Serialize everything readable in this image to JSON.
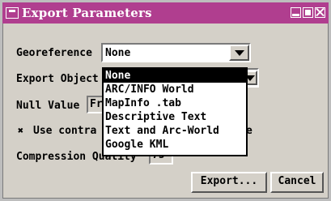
{
  "window": {
    "title": "Export Parameters"
  },
  "fields": {
    "georeference": {
      "label": "Georeference",
      "value": "None"
    },
    "export_objects": {
      "label": "Export Objects",
      "label_visible": "Export Object"
    },
    "null_value": {
      "label": "Null Value",
      "value_visible": "Fr"
    },
    "contrast": {
      "label": "Use contrast",
      "label_left": "Use contra",
      "label_right": "e",
      "checked": true,
      "check_glyph": "✖"
    },
    "compression": {
      "label": "Compression Quality",
      "label_visible": "Compression Quality",
      "value": "75",
      "value_visible": "75"
    }
  },
  "dropdown": {
    "options": [
      "None",
      "ARC/INFO World",
      "MapInfo .tab",
      "Descriptive Text",
      "Text and Arc-World",
      "Google KML"
    ],
    "selected_index": 0
  },
  "buttons": {
    "export": "Export...",
    "cancel": "Cancel"
  }
}
